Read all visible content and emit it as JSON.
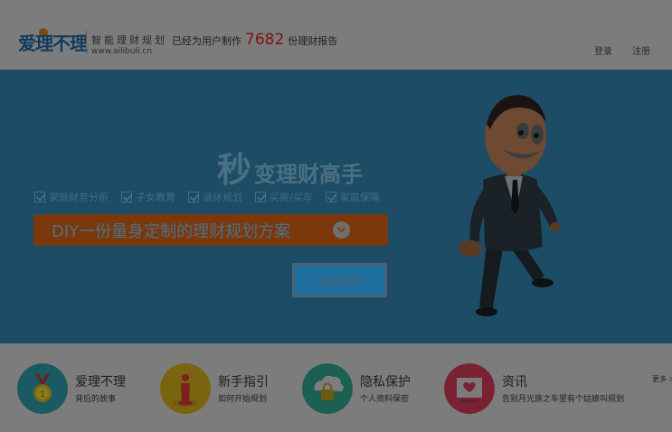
{
  "header": {
    "logo_text": "爱理不理",
    "slogan": "智能理财规划",
    "site_url": "www.ailibuli.cn",
    "stat_prefix": "已经为用户制作",
    "stat_count": "7682",
    "stat_suffix": "份理财报告",
    "login": "登录",
    "register": "注册"
  },
  "banner": {
    "headline_big": "秒",
    "headline_rest": "变理财高手",
    "features": [
      "家庭财务分析",
      "子女教育",
      "退休规划",
      "买房/买车",
      "家庭保障"
    ],
    "diy_text": "DIY一份量身定制的理财规划方案",
    "plan_button": "立即规划"
  },
  "entries": [
    {
      "title": "爱理不理",
      "sub": "背后的故事",
      "icon": "medal-icon",
      "color": "#1a5a63"
    },
    {
      "title": "新手指引",
      "sub": "如何开始规划",
      "icon": "figure-target-icon",
      "color": "#7b6410"
    },
    {
      "title": "隐私保护",
      "sub": "个人资料保密",
      "icon": "cloud-lock-icon",
      "color": "#1b6052"
    },
    {
      "title": "资讯",
      "sub": "告别月光族之车里有个姑娘叫规划",
      "icon": "heart-letter-icon",
      "color": "#7a2233"
    }
  ],
  "more_label": "更多 >",
  "colors": {
    "banner_bg": "#1d4d66",
    "overlay_gray": "#7c7c7c",
    "accent_orange": "#7a380c",
    "count_red": "#7a1313"
  }
}
